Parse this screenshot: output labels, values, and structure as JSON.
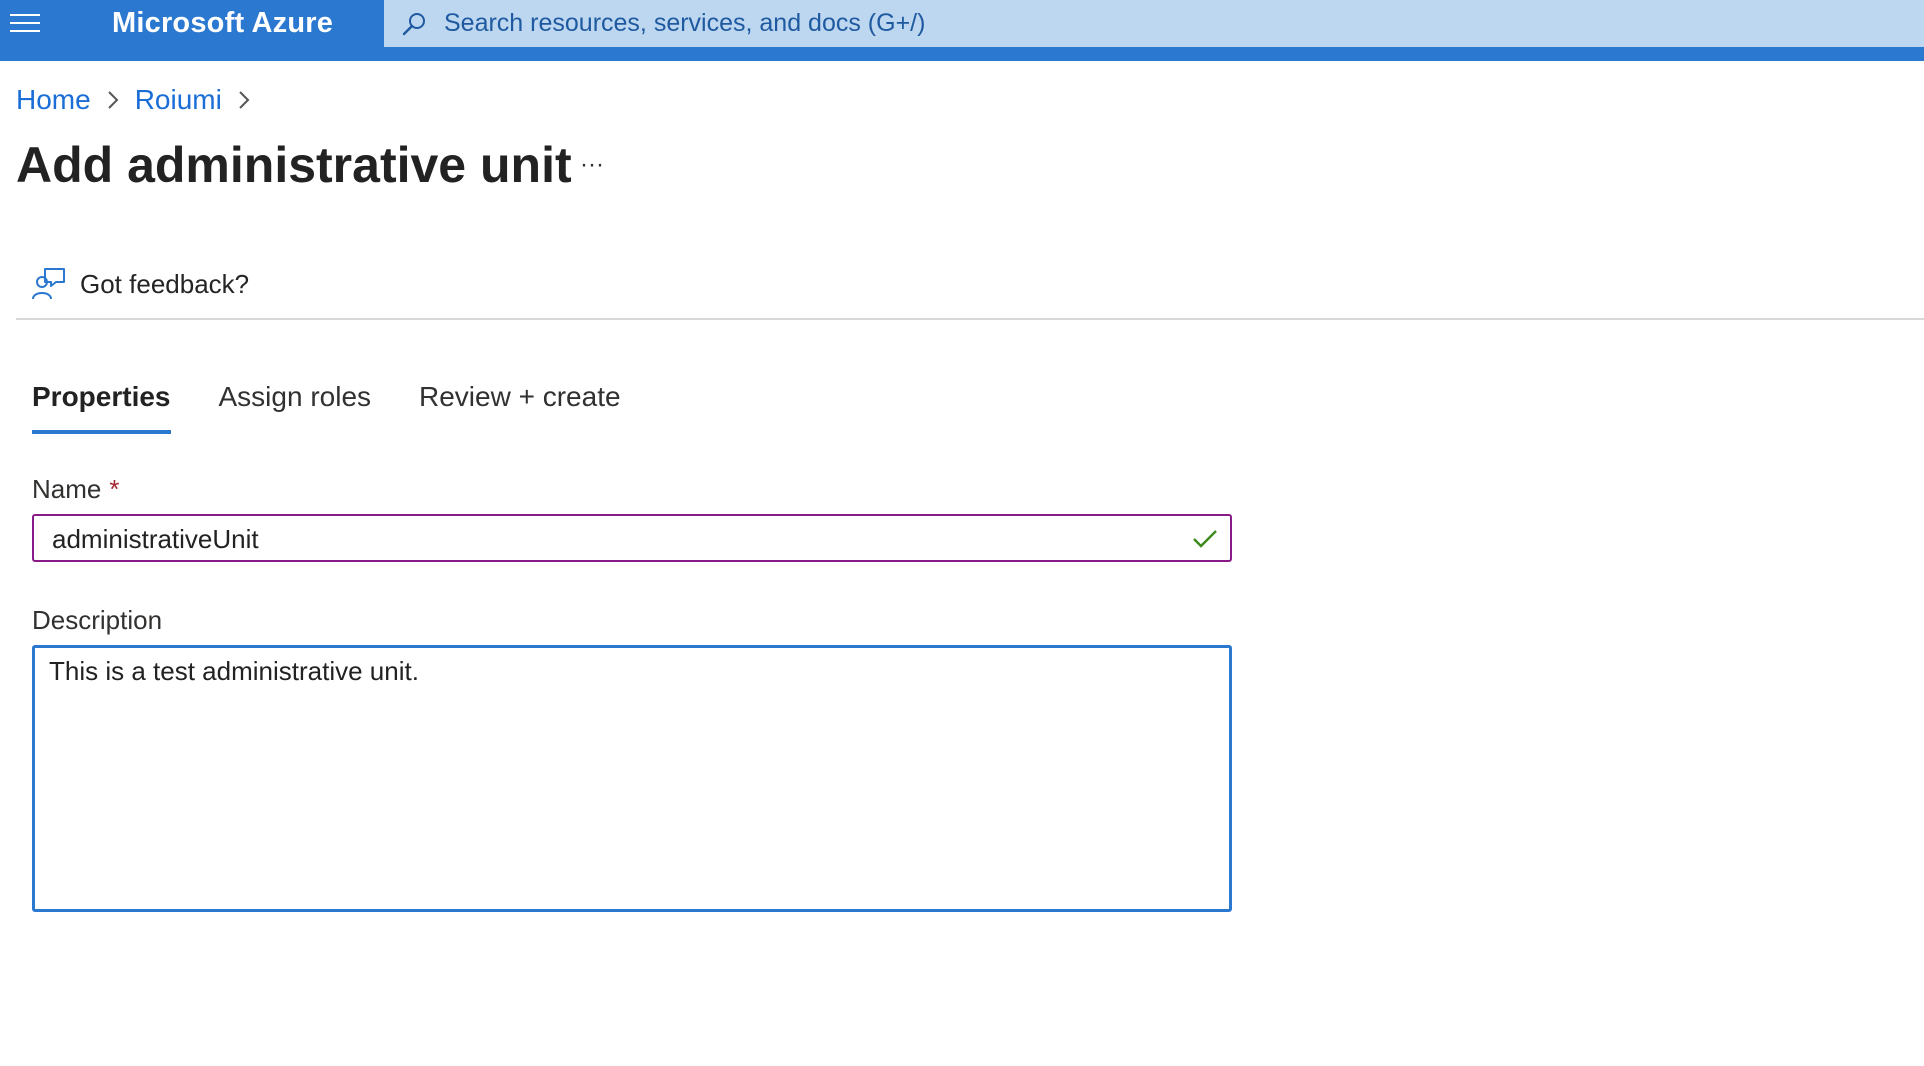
{
  "topbar": {
    "menu_icon": "hamburger-menu-icon",
    "brand": "Microsoft Azure",
    "search": {
      "icon": "search-icon",
      "placeholder": "Search resources, services, and docs (G+/)"
    },
    "colors": {
      "bar": "#2b78d0",
      "search_bg": "#bdd7f0"
    }
  },
  "breadcrumb": {
    "items": [
      {
        "label": "Home"
      },
      {
        "label": "Roiumi"
      }
    ],
    "separator_icon": "chevron-right-icon"
  },
  "page": {
    "title": "Add administrative unit",
    "more_label": "···"
  },
  "toolbar": {
    "feedback_label": "Got feedback?",
    "feedback_icon": "feedback-person-icon"
  },
  "tabs": [
    {
      "label": "Properties",
      "active": true
    },
    {
      "label": "Assign roles",
      "active": false
    },
    {
      "label": "Review + create",
      "active": false
    }
  ],
  "form": {
    "name": {
      "label": "Name",
      "required_mark": "*",
      "value": "administrativeUnit",
      "valid_icon": "checkmark-icon"
    },
    "description": {
      "label": "Description",
      "value": "This is a test administrative unit."
    }
  }
}
